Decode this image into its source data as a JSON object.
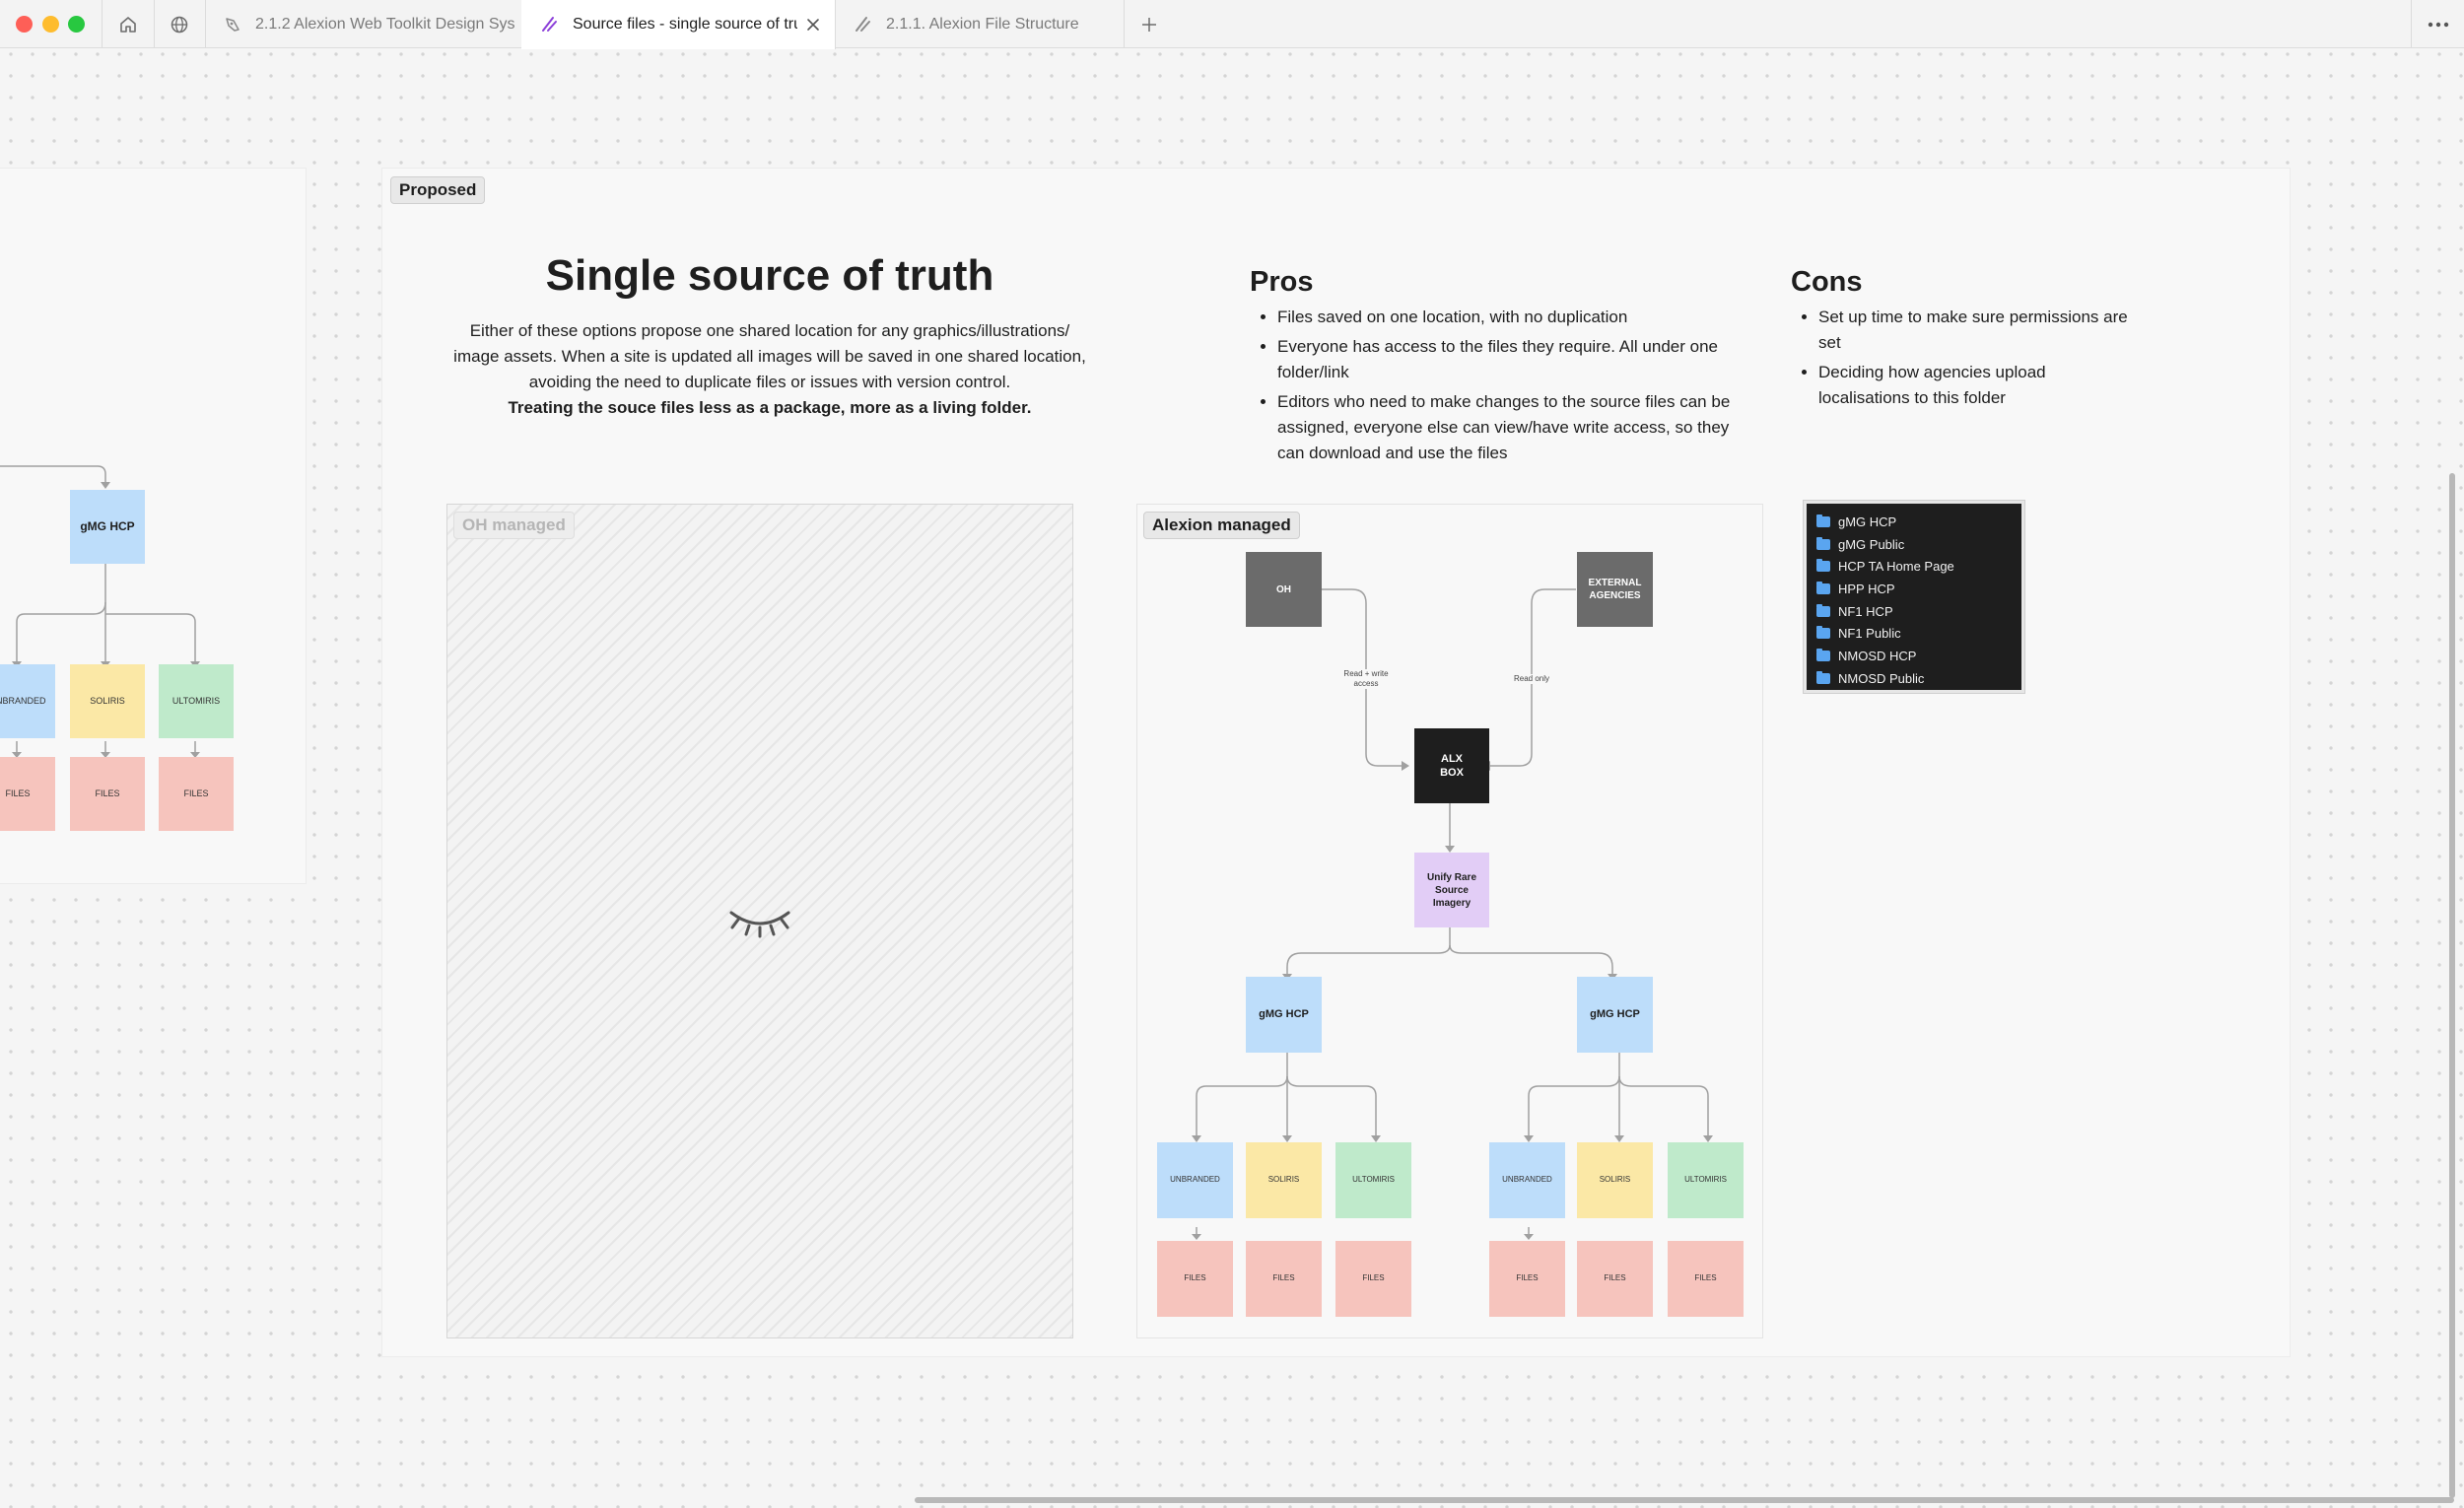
{
  "tabs": [
    {
      "label": "2.1.2 Alexion Web Toolkit Design Sys"
    },
    {
      "label": "Source files - single source of tru"
    },
    {
      "label": "2.1.1. Alexion File Structure"
    }
  ],
  "left_frame": {
    "root": "gMG HCP",
    "children": [
      "UNBRANDED",
      "SOLIRIS",
      "ULTOMIRIS"
    ],
    "files": [
      "FILES",
      "FILES",
      "FILES"
    ]
  },
  "main_frame": {
    "badge": "Proposed",
    "title": "Single source of truth",
    "description": "Either of these options propose one shared location for any graphics/illustrations/ image assets. When a site is updated all images will be saved in one shared location, avoiding the need to duplicate files or issues with version control.",
    "description_bold": "Treating the souce files less as a package, more as a living folder.",
    "pros": {
      "heading": "Pros",
      "items": [
        "Files saved on one location, with no duplication",
        "Everyone has access to the files they require. All under one folder/link",
        "Editors who need to make changes to the source files can be assigned, everyone else can view/have write access, so they can download and use the files"
      ]
    },
    "cons": {
      "heading": "Cons",
      "items": [
        "Set up time to make sure permissions are set",
        "Deciding how agencies upload localisations to this folder"
      ]
    },
    "oh_panel": {
      "label": "OH managed",
      "icon": "closed-eye-icon"
    },
    "alexion_panel": {
      "label": "Alexion managed",
      "oh": "OH",
      "external": "EXTERNAL AGENCIES",
      "read_write": "Read + write access",
      "read_only": "Read only",
      "alx_box": "ALX BOX",
      "unify": "Unify Rare Source Imagery",
      "groups": [
        {
          "title": "gMG HCP",
          "children": [
            "UNBRANDED",
            "SOLIRIS",
            "ULTOMIRIS"
          ],
          "files": [
            "FILES",
            "FILES",
            "FILES"
          ]
        },
        {
          "title": "gMG HCP",
          "children": [
            "UNBRANDED",
            "SOLIRIS",
            "ULTOMIRIS"
          ],
          "files": [
            "FILES",
            "FILES",
            "FILES"
          ]
        }
      ]
    },
    "folder_list": [
      "gMG HCP",
      "gMG Public",
      "HCP TA Home Page",
      "HPP HCP",
      "NF1 HCP",
      "NF1 Public",
      "NMOSD HCP",
      "NMOSD Public"
    ]
  },
  "colors": {
    "blue": "#bdddfa",
    "yellow": "#fbe8a6",
    "green": "#bfeacb",
    "pink": "#f6c4bd",
    "lilac": "#e2cdf6",
    "folder": "#5aa5f0",
    "accent_tab_icon": "#8b3fd9"
  }
}
